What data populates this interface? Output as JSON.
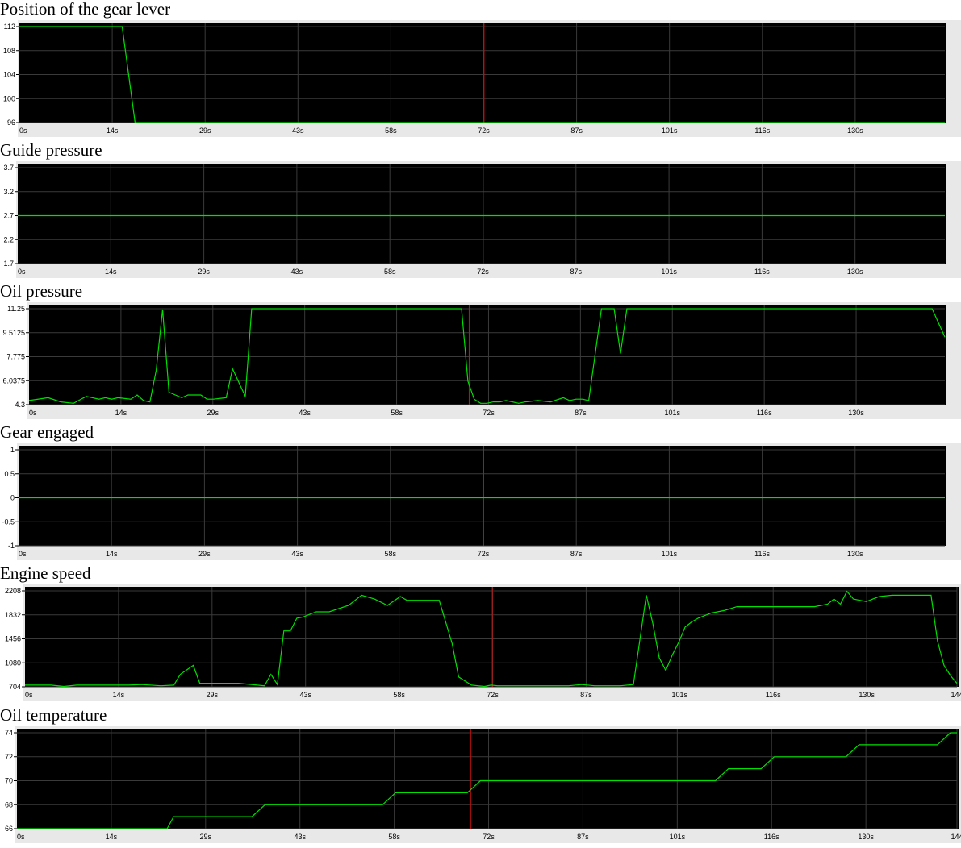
{
  "chart_data": [
    {
      "type": "line",
      "title": "Position of the gear lever",
      "ylim": [
        96,
        112
      ],
      "yticks": [
        "112",
        "108",
        "104",
        "100",
        "96"
      ],
      "xlim": [
        0,
        144
      ],
      "xticks": [
        "0s",
        "14s",
        "29s",
        "43s",
        "58s",
        "72s",
        "87s",
        "101s",
        "116s",
        "130s"
      ],
      "cursor_x": 72.3,
      "grid": true,
      "line_color": "#00e000",
      "background": "#000000",
      "cursor_color": "#d01010",
      "x": [
        0,
        16,
        18,
        144
      ],
      "values": [
        112,
        112,
        96,
        96
      ]
    },
    {
      "type": "line",
      "title": "Guide pressure",
      "ylim": [
        1.7,
        3.7
      ],
      "yticks": [
        "3.7",
        "3.2",
        "2.7",
        "2.2",
        "1.7"
      ],
      "xlim": [
        0,
        144
      ],
      "xticks": [
        "0s",
        "14s",
        "29s",
        "43s",
        "58s",
        "72s",
        "87s",
        "101s",
        "116s",
        "130s"
      ],
      "cursor_x": 72.3,
      "grid": true,
      "line_color": "#00e000",
      "background": "#000000",
      "cursor_color": "#d01010",
      "x": [
        0,
        144
      ],
      "values": [
        2.7,
        2.7
      ]
    },
    {
      "type": "line",
      "title": "Oil pressure",
      "ylim": [
        4.3,
        11.25
      ],
      "yticks": [
        "11.25",
        "9.5125",
        "7.775",
        "6.0375",
        "4.3"
      ],
      "xlim": [
        0,
        144
      ],
      "xticks": [
        "0s",
        "14s",
        "29s",
        "43s",
        "58s",
        "72s",
        "87s",
        "101s",
        "116s",
        "130s"
      ],
      "cursor_x": 69.2,
      "grid": true,
      "line_color": "#00e000",
      "background": "#000000",
      "cursor_color": "#d01010",
      "x": [
        0,
        3,
        5,
        7,
        9,
        11,
        12,
        13,
        14,
        16,
        17,
        18,
        19,
        20,
        21,
        22,
        23,
        24,
        25,
        27,
        28,
        29,
        31,
        32,
        34,
        35,
        36,
        37,
        38,
        39,
        40,
        41,
        42,
        43,
        44,
        68,
        69,
        70,
        71,
        72,
        73,
        74,
        75,
        76,
        77,
        78,
        80,
        82,
        84,
        85,
        86,
        87,
        88,
        90,
        92,
        93,
        94,
        95,
        96,
        97,
        98,
        99,
        100,
        101,
        102,
        103,
        104,
        105,
        106,
        107,
        108,
        109,
        110,
        111,
        112,
        140,
        142,
        144
      ],
      "values": [
        4.6,
        4.8,
        4.5,
        4.4,
        4.9,
        4.7,
        4.8,
        4.7,
        4.8,
        4.7,
        5.0,
        4.6,
        4.5,
        6.8,
        11.2,
        5.2,
        5.0,
        4.8,
        5.0,
        5.0,
        4.7,
        4.7,
        4.8,
        6.9,
        4.9,
        11.25,
        11.25,
        11.25,
        11.25,
        11.25,
        11.25,
        11.25,
        11.25,
        11.25,
        11.25,
        11.25,
        6.0,
        4.7,
        4.4,
        4.4,
        4.5,
        4.5,
        4.6,
        4.5,
        4.4,
        4.5,
        4.6,
        4.5,
        4.8,
        4.6,
        4.7,
        4.7,
        4.6,
        11.25,
        11.25,
        8.0,
        11.25,
        11.25,
        11.25,
        11.25,
        11.25,
        11.25,
        11.25,
        11.25,
        11.25,
        11.25,
        11.25,
        11.25,
        11.25,
        11.25,
        11.25,
        11.25,
        11.25,
        11.25,
        11.25,
        11.25,
        11.25,
        9.2
      ]
    },
    {
      "type": "line",
      "title": "Gear engaged",
      "ylim": [
        -1,
        1
      ],
      "yticks": [
        "1",
        "0.5",
        "0",
        "-0.5",
        "-1"
      ],
      "xlim": [
        0,
        144
      ],
      "xticks": [
        "0s",
        "14s",
        "29s",
        "43s",
        "58s",
        "72s",
        "87s",
        "101s",
        "116s",
        "130s"
      ],
      "cursor_x": 72.3,
      "grid": true,
      "line_color": "#00e000",
      "background": "#000000",
      "cursor_color": "#d01010",
      "x": [
        0,
        144
      ],
      "values": [
        0,
        0
      ]
    },
    {
      "type": "line",
      "title": "Engine speed",
      "ylim": [
        704,
        2208
      ],
      "yticks": [
        "2208",
        "1832",
        "1456",
        "1080",
        "704"
      ],
      "xlim": [
        0,
        144
      ],
      "xticks": [
        "0s",
        "14s",
        "29s",
        "43s",
        "58s",
        "72s",
        "87s",
        "101s",
        "116s",
        "130s",
        "144"
      ],
      "cursor_x": 72.2,
      "grid": true,
      "line_color": "#00e000",
      "background": "#000000",
      "cursor_color": "#d01010",
      "x": [
        0,
        4,
        6,
        8,
        10,
        14,
        16,
        18,
        21,
        23,
        24,
        26,
        27,
        29,
        33,
        37,
        38,
        39,
        40,
        41,
        42,
        43,
        44,
        45,
        47,
        50,
        52,
        54,
        56,
        58,
        59,
        61,
        62,
        64,
        66,
        67,
        69,
        70,
        71,
        72,
        73,
        76,
        80,
        84,
        86,
        88,
        92,
        94,
        96,
        97,
        98,
        99,
        100,
        101,
        102,
        103,
        104,
        105,
        106,
        107,
        108,
        110,
        112,
        113,
        114,
        115,
        116,
        117,
        118,
        120,
        122,
        124,
        125,
        126,
        127,
        128,
        129,
        130,
        131,
        132,
        134,
        136,
        140,
        141,
        142,
        143,
        144
      ],
      "values": [
        730,
        730,
        710,
        730,
        730,
        730,
        730,
        740,
        720,
        730,
        900,
        1040,
        760,
        760,
        760,
        720,
        900,
        740,
        1580,
        1580,
        1780,
        1800,
        1840,
        1880,
        1880,
        1980,
        2140,
        2080,
        1980,
        2120,
        2060,
        2060,
        2060,
        2060,
        1380,
        860,
        730,
        720,
        710,
        730,
        720,
        720,
        720,
        720,
        740,
        720,
        720,
        740,
        2140,
        1700,
        1160,
        960,
        1200,
        1400,
        1640,
        1720,
        1780,
        1820,
        1860,
        1880,
        1900,
        1960,
        1960,
        1960,
        1960,
        1960,
        1960,
        1960,
        1960,
        1960,
        1960,
        2000,
        2080,
        2000,
        2200,
        2080,
        2060,
        2040,
        2080,
        2120,
        2140,
        2140,
        2140,
        1420,
        1040,
        880,
        760
      ]
    },
    {
      "type": "line",
      "title": "Oil temperature",
      "ylim": [
        66,
        74
      ],
      "yticks": [
        "74",
        "72",
        "70",
        "68",
        "66"
      ],
      "xlim": [
        0,
        144
      ],
      "xticks": [
        "0s",
        "14s",
        "29s",
        "43s",
        "58s",
        "72s",
        "87s",
        "101s",
        "116s",
        "130s",
        "144"
      ],
      "cursor_x": 69.5,
      "grid": true,
      "line_color": "#00e000",
      "background": "#000000",
      "cursor_color": "#d01010",
      "x": [
        0,
        23,
        24,
        36,
        38,
        56,
        58,
        69,
        71,
        107,
        109,
        114,
        116,
        127,
        129,
        141,
        143,
        144
      ],
      "values": [
        66,
        66,
        67,
        67,
        68,
        68,
        69,
        69,
        70,
        70,
        71,
        71,
        72,
        72,
        73,
        73,
        74,
        74
      ]
    }
  ]
}
